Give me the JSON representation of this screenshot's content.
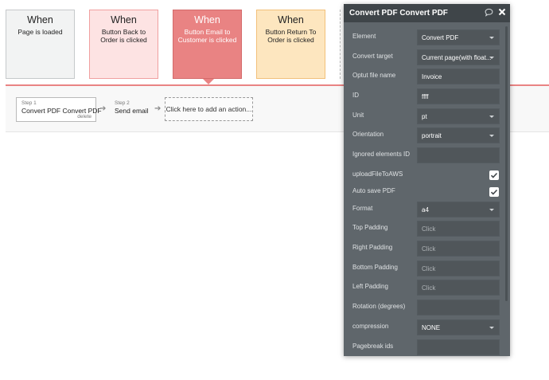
{
  "events": [
    {
      "when": "When",
      "desc": "Page is loaded"
    },
    {
      "when": "When",
      "desc": "Button Back to Order is clicked"
    },
    {
      "when": "When",
      "desc": "Button Email to Customer is clicked"
    },
    {
      "when": "When",
      "desc": "Button Return To Order is clicked"
    }
  ],
  "steps": [
    {
      "label": "Step 1",
      "title": "Convert PDF Convert PDF",
      "delete": "delete"
    },
    {
      "label": "Step 2",
      "title": "Send email"
    }
  ],
  "add_action": "Click here to add an action...",
  "panel": {
    "title": "Convert PDF Convert PDF",
    "icons": [
      "comment-icon",
      "close-icon"
    ],
    "fields": {
      "element": {
        "label": "Element",
        "value": "Convert PDF"
      },
      "convert_target": {
        "label": "Convert target",
        "value": "Current page(with float..."
      },
      "output_name": {
        "label": "Optut file name",
        "value": "Invoice"
      },
      "id": {
        "label": "ID",
        "value": "ffff"
      },
      "unit": {
        "label": "Unit",
        "value": "pt"
      },
      "orientation": {
        "label": "Orientation",
        "value": "portrait"
      },
      "ignored": {
        "label": "Ignored elements ID",
        "value": ""
      },
      "upload": {
        "label": "uploadFileToAWS",
        "checked": true
      },
      "autosave": {
        "label": "Auto save PDF",
        "checked": true
      },
      "format": {
        "label": "Format",
        "value": "a4"
      },
      "top_padding": {
        "label": "Top Padding",
        "placeholder": "Click"
      },
      "right_padding": {
        "label": "Right Padding",
        "placeholder": "Click"
      },
      "bottom_padding": {
        "label": "Bottom Padding",
        "placeholder": "Click"
      },
      "left_padding": {
        "label": "Left Padding",
        "placeholder": "Click"
      },
      "rotation": {
        "label": "Rotation (degrees)",
        "value": ""
      },
      "compression": {
        "label": "compression",
        "value": "NONE"
      },
      "pagebreak": {
        "label": "Pagebreak ids",
        "value": ""
      }
    }
  },
  "colors": {
    "active_event": "#e98383",
    "panel_bg": "#5f666b",
    "panel_header": "#3f4549"
  }
}
